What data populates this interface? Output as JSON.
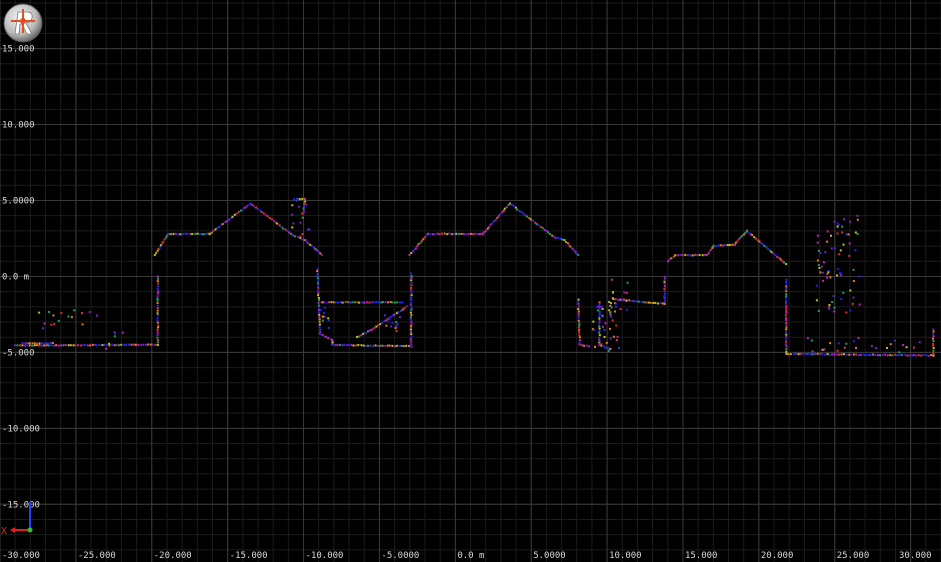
{
  "app": {
    "logo_icon": "rviz-logo-icon"
  },
  "view": {
    "x_units": "m",
    "y_units": "m",
    "x_range": [
      -30,
      32
    ],
    "y_range": [
      -18.8,
      18.2
    ],
    "x_ticks": [
      {
        "value": -30,
        "label": "-30.000"
      },
      {
        "value": -25,
        "label": "-25.000"
      },
      {
        "value": -20,
        "label": "-20.000"
      },
      {
        "value": -15,
        "label": "-15.000"
      },
      {
        "value": -10,
        "label": "-10.000"
      },
      {
        "value": -5,
        "label": "-5.0000"
      },
      {
        "value": 0,
        "label": "0.0 m"
      },
      {
        "value": 5,
        "label": "5.0000"
      },
      {
        "value": 10,
        "label": "10.000"
      },
      {
        "value": 15,
        "label": "15.000"
      },
      {
        "value": 20,
        "label": "20.000"
      },
      {
        "value": 25,
        "label": "25.000"
      },
      {
        "value": 30,
        "label": "30.000"
      }
    ],
    "y_ticks": [
      {
        "value": 15,
        "label": "15.000"
      },
      {
        "value": 10,
        "label": "10.000"
      },
      {
        "value": 5,
        "label": "5.0000"
      },
      {
        "value": 0,
        "label": "0.0 m"
      },
      {
        "value": -5,
        "label": "-5.000"
      },
      {
        "value": -10,
        "label": "-10.000"
      },
      {
        "value": -15,
        "label": "-15.000"
      }
    ],
    "grid": true,
    "grid_step": 1,
    "axis_gizmo": {
      "x_label": "X",
      "x_color": "#e02020",
      "y_color": "#2040ff",
      "z_color": "#30c030"
    },
    "colors": {
      "background": "#000000",
      "grid": "#3a3a3a",
      "label": "#d8d8d8"
    }
  },
  "chart_data": {
    "type": "scatter",
    "title": "",
    "xlabel": "",
    "ylabel": "",
    "xlim": [
      -30,
      32
    ],
    "ylim": [
      -18.8,
      18.2
    ],
    "grid": true,
    "point_colors": [
      "#2020ff",
      "#3030e0",
      "#8020c0",
      "#c020c0",
      "#20a060",
      "#c0c020",
      "#e03030",
      "#e08020"
    ],
    "series": [
      {
        "name": "",
        "kind": "polyline",
        "points": [
          [
            -29,
            -4.55
          ],
          [
            -19.6,
            -4.5
          ],
          [
            -19.6,
            0
          ]
        ]
      },
      {
        "name": "",
        "kind": "polyline",
        "points": [
          [
            -19.8,
            1.4
          ],
          [
            -18.9,
            2.8
          ],
          [
            -16.2,
            2.8
          ],
          [
            -13.5,
            4.8
          ],
          [
            -10.7,
            2.7
          ],
          [
            -9.9,
            2.4
          ],
          [
            -9.2,
            1.8
          ],
          [
            -8.8,
            1.4
          ]
        ]
      },
      {
        "name": "",
        "kind": "polyline",
        "points": [
          [
            -9.1,
            0.5
          ],
          [
            -8.9,
            -3.8
          ],
          [
            -8.1,
            -4.2
          ],
          [
            -8.1,
            -4.5
          ],
          [
            -2.9,
            -4.6
          ],
          [
            -2.9,
            0.2
          ]
        ]
      },
      {
        "name": "",
        "kind": "polyline",
        "points": [
          [
            -8.8,
            -1.7
          ],
          [
            -3.5,
            -1.7
          ]
        ]
      },
      {
        "name": "",
        "kind": "polyline",
        "points": [
          [
            -6.5,
            -4.0
          ],
          [
            -5.5,
            -3.5
          ],
          [
            -4.0,
            -2.5
          ],
          [
            -3.2,
            -2.0
          ]
        ]
      },
      {
        "name": "",
        "kind": "polyline",
        "points": [
          [
            -3.0,
            1.4
          ],
          [
            -1.8,
            2.8
          ],
          [
            1.8,
            2.8
          ],
          [
            3.6,
            4.8
          ],
          [
            6.5,
            2.6
          ],
          [
            7.2,
            2.4
          ],
          [
            8.1,
            1.4
          ]
        ]
      },
      {
        "name": "",
        "kind": "polyline",
        "points": [
          [
            8.1,
            -1.5
          ],
          [
            8.2,
            -4.5
          ],
          [
            8.8,
            -4.6
          ]
        ]
      },
      {
        "name": "",
        "kind": "polyline",
        "points": [
          [
            9.5,
            -1.7
          ],
          [
            9.5,
            -4.5
          ],
          [
            10.2,
            -4.8
          ]
        ]
      },
      {
        "name": "",
        "kind": "polyline",
        "points": [
          [
            10.4,
            -1.5
          ],
          [
            13.8,
            -1.8
          ],
          [
            13.8,
            0
          ]
        ]
      },
      {
        "name": "",
        "kind": "polyline",
        "points": [
          [
            14.0,
            1.0
          ],
          [
            14.5,
            1.4
          ],
          [
            16.6,
            1.4
          ],
          [
            17.0,
            2.0
          ],
          [
            18.4,
            2.1
          ],
          [
            19.2,
            3.0
          ],
          [
            21.8,
            0.8
          ]
        ]
      },
      {
        "name": "",
        "kind": "polyline",
        "points": [
          [
            21.8,
            -0.2
          ],
          [
            21.8,
            -5.1
          ],
          [
            31.5,
            -5.2
          ],
          [
            31.5,
            -3.5
          ]
        ]
      },
      {
        "name": "",
        "kind": "polyline",
        "points": [
          [
            -28.5,
            -4.4
          ],
          [
            -26.5,
            -4.4
          ]
        ]
      },
      {
        "name": "",
        "kind": "polyline",
        "points": [
          [
            -10.6,
            5.1
          ],
          [
            -9.9,
            5.1
          ],
          [
            -10.0,
            4.2
          ]
        ]
      },
      {
        "name": "",
        "kind": "cluster",
        "center": [
          -25.5,
          -2.5
        ],
        "spread": [
          2.0,
          1.0
        ],
        "count": 16
      },
      {
        "name": "",
        "kind": "cluster",
        "center": [
          -22.5,
          -4.0
        ],
        "spread": [
          0.6,
          0.8
        ],
        "count": 6
      },
      {
        "name": "",
        "kind": "cluster",
        "center": [
          -10.2,
          3.8
        ],
        "spread": [
          0.6,
          1.2
        ],
        "count": 14
      },
      {
        "name": "",
        "kind": "cluster",
        "center": [
          9.9,
          -3.3
        ],
        "spread": [
          0.9,
          1.8
        ],
        "count": 40
      },
      {
        "name": "",
        "kind": "cluster",
        "center": [
          10.8,
          -1.2
        ],
        "spread": [
          0.6,
          1.0
        ],
        "count": 12
      },
      {
        "name": "",
        "kind": "cluster",
        "center": [
          -3.9,
          -3.2
        ],
        "spread": [
          0.8,
          0.8
        ],
        "count": 12
      },
      {
        "name": "",
        "kind": "cluster",
        "center": [
          25.2,
          0.8
        ],
        "spread": [
          1.5,
          3.2
        ],
        "count": 70
      },
      {
        "name": "",
        "kind": "cluster",
        "center": [
          25.0,
          -4.5
        ],
        "spread": [
          1.8,
          0.5
        ],
        "count": 14
      },
      {
        "name": "",
        "kind": "cluster",
        "center": [
          29.0,
          -4.6
        ],
        "spread": [
          2.0,
          0.4
        ],
        "count": 10
      },
      {
        "name": "",
        "kind": "cluster",
        "center": [
          -8.6,
          -2.8
        ],
        "spread": [
          0.3,
          1.4
        ],
        "count": 10
      }
    ]
  }
}
